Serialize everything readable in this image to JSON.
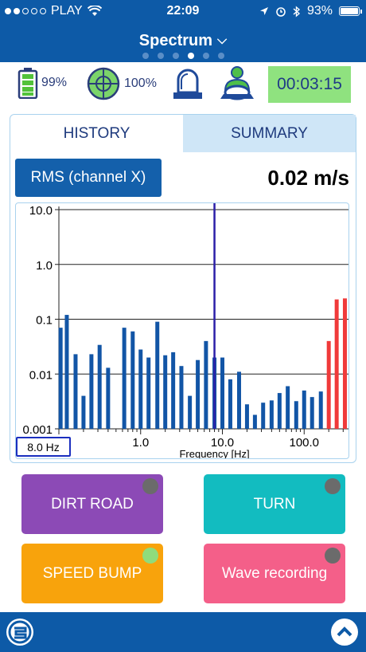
{
  "status_bar": {
    "carrier": "PLAY",
    "time": "22:09",
    "battery": "93%"
  },
  "header": {
    "title": "Spectrum",
    "page_count": 6,
    "active_page": 4
  },
  "status_icons": {
    "battery_level": "99%",
    "gps_quality": "100%",
    "timer": "00:03:15"
  },
  "tabs": [
    {
      "label": "HISTORY",
      "active": true
    },
    {
      "label": "SUMMARY",
      "active": false
    }
  ],
  "metric": {
    "label": "RMS (channel X)",
    "value": "0.02 m/s"
  },
  "cursor_frequency": "8.0 Hz",
  "chart_data": {
    "type": "bar",
    "scale": "log-log",
    "xlabel": "Frequency [Hz]",
    "x_ticks": [
      "1.0",
      "10.0",
      "100.0"
    ],
    "y_ticks": [
      "10.0",
      "1.0",
      "0.1",
      "0.01",
      "0.001"
    ],
    "ylim": [
      0.001,
      10
    ],
    "xlim": [
      0.1,
      350
    ],
    "cursor_hz": 8.0,
    "colors": {
      "normal": "#1255a6",
      "alarm": "#f03a3a",
      "cursor": "#2c1fa8"
    },
    "bars": [
      {
        "f": 0.105,
        "v": 0.07,
        "alarm": false
      },
      {
        "f": 0.125,
        "v": 0.12,
        "alarm": false
      },
      {
        "f": 0.16,
        "v": 0.023,
        "alarm": false
      },
      {
        "f": 0.2,
        "v": 0.004,
        "alarm": false
      },
      {
        "f": 0.25,
        "v": 0.023,
        "alarm": false
      },
      {
        "f": 0.315,
        "v": 0.034,
        "alarm": false
      },
      {
        "f": 0.4,
        "v": 0.013,
        "alarm": false
      },
      {
        "f": 0.63,
        "v": 0.07,
        "alarm": false
      },
      {
        "f": 0.8,
        "v": 0.06,
        "alarm": false
      },
      {
        "f": 1.0,
        "v": 0.028,
        "alarm": false
      },
      {
        "f": 1.25,
        "v": 0.02,
        "alarm": false
      },
      {
        "f": 1.6,
        "v": 0.09,
        "alarm": false
      },
      {
        "f": 2.0,
        "v": 0.022,
        "alarm": false
      },
      {
        "f": 2.5,
        "v": 0.025,
        "alarm": false
      },
      {
        "f": 3.15,
        "v": 0.014,
        "alarm": false
      },
      {
        "f": 4.0,
        "v": 0.004,
        "alarm": false
      },
      {
        "f": 5.0,
        "v": 0.018,
        "alarm": false
      },
      {
        "f": 6.3,
        "v": 0.04,
        "alarm": false
      },
      {
        "f": 8.0,
        "v": 0.02,
        "alarm": false
      },
      {
        "f": 10.0,
        "v": 0.02,
        "alarm": false
      },
      {
        "f": 12.5,
        "v": 0.008,
        "alarm": false
      },
      {
        "f": 16.0,
        "v": 0.011,
        "alarm": false
      },
      {
        "f": 20.0,
        "v": 0.0028,
        "alarm": false
      },
      {
        "f": 25.0,
        "v": 0.0018,
        "alarm": false
      },
      {
        "f": 31.5,
        "v": 0.003,
        "alarm": false
      },
      {
        "f": 40.0,
        "v": 0.0033,
        "alarm": false
      },
      {
        "f": 50.0,
        "v": 0.0045,
        "alarm": false
      },
      {
        "f": 63.0,
        "v": 0.006,
        "alarm": false
      },
      {
        "f": 80.0,
        "v": 0.0032,
        "alarm": false
      },
      {
        "f": 100.0,
        "v": 0.005,
        "alarm": false
      },
      {
        "f": 125.0,
        "v": 0.0038,
        "alarm": false
      },
      {
        "f": 160.0,
        "v": 0.0048,
        "alarm": false
      },
      {
        "f": 200.0,
        "v": 0.04,
        "alarm": true
      },
      {
        "f": 250.0,
        "v": 0.23,
        "alarm": true
      },
      {
        "f": 315.0,
        "v": 0.24,
        "alarm": true
      }
    ]
  },
  "event_buttons": [
    {
      "label": "DIRT ROAD",
      "led_color": "#6b6b6b"
    },
    {
      "label": "TURN",
      "led_color": "#6b6b6b"
    },
    {
      "label": "SPEED BUMP",
      "led_color": "#8fdc7c"
    },
    {
      "label": "Wave recording",
      "led_color": "#6b6b6b"
    }
  ]
}
